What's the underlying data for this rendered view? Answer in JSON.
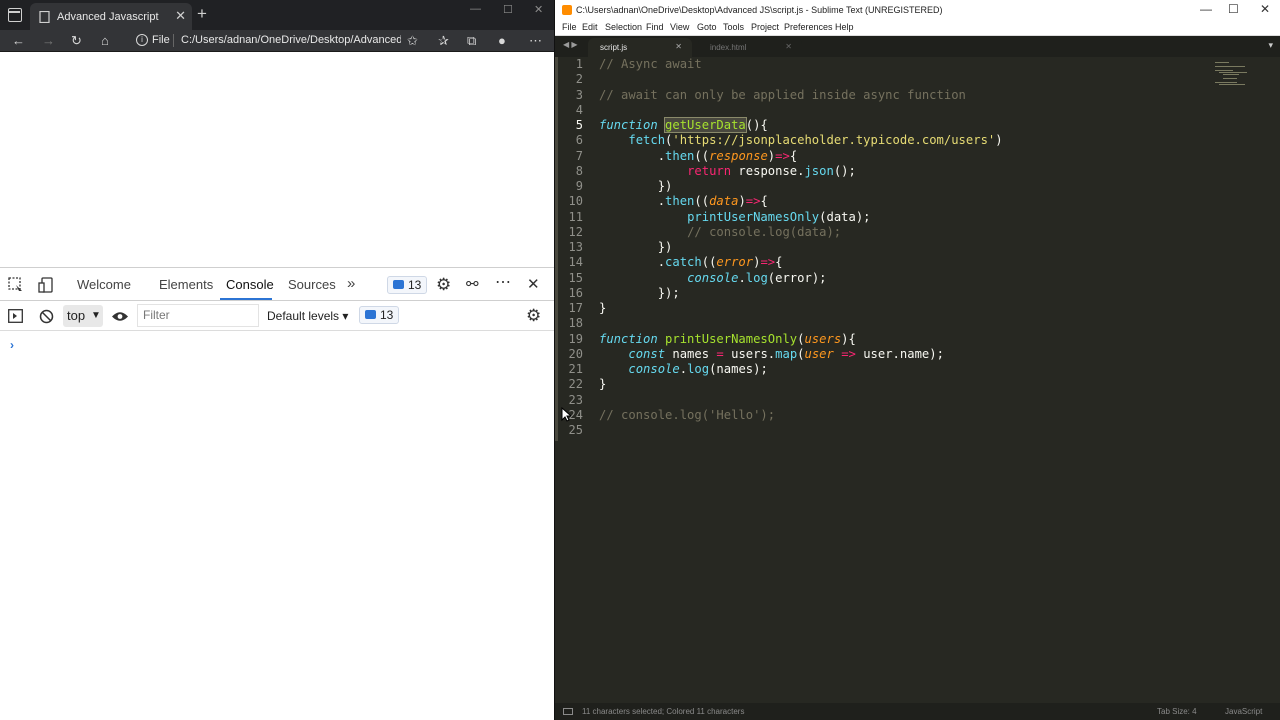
{
  "browser": {
    "tab_title": "Advanced Javascript",
    "tab_close": "✕",
    "new_tab": "+",
    "address": {
      "scheme_label": "File",
      "url": "C:/Users/adnan/OneDrive/Desktop/Advanced%20J..."
    }
  },
  "devtools": {
    "tabs": [
      "Welcome",
      "Elements",
      "Console",
      "Sources"
    ],
    "more_tabs": "»",
    "issues_count": "13",
    "close": "✕",
    "context": "top",
    "filter_placeholder": "Filter",
    "levels": "Default levels",
    "messages_count": "13",
    "prompt": "›"
  },
  "sublime": {
    "title": "C:\\Users\\adnan\\OneDrive\\Desktop\\Advanced JS\\script.js - Sublime Text (UNREGISTERED)",
    "menu": [
      "File",
      "Edit",
      "Selection",
      "Find",
      "View",
      "Goto",
      "Tools",
      "Project",
      "Preferences",
      "Help"
    ],
    "tabs": [
      {
        "name": "script.js",
        "active": true
      },
      {
        "name": "index.html",
        "active": false
      }
    ],
    "current_line": 5,
    "line_numbers": [
      "1",
      "2",
      "3",
      "4",
      "5",
      "6",
      "7",
      "8",
      "9",
      "10",
      "11",
      "12",
      "13",
      "14",
      "15",
      "16",
      "17",
      "18",
      "19",
      "20",
      "21",
      "22",
      "23",
      "24",
      "25"
    ],
    "code": {
      "l1": "// Async await",
      "l3": "// await can only be applied inside async function",
      "l5_kw": "function",
      "l5_fn": "getUserData",
      "l5_rest": "(){",
      "l6_fn": "fetch",
      "l6_p1": "(",
      "l6_str": "'https://jsonplaceholder.typicode.com/users'",
      "l6_p2": ")",
      "l7_a": ".",
      "l7_fn": "then",
      "l7_b": "((",
      "l7_param": "response",
      "l7_c": ")",
      "l7_op": "=>",
      "l7_d": "{",
      "l8_kw": "return",
      "l8_a": " response.",
      "l8_fn": "json",
      "l8_b": "();",
      "l9": "})",
      "l10_a": ".",
      "l10_fn": "then",
      "l10_b": "((",
      "l10_param": "data",
      "l10_c": ")",
      "l10_op": "=>",
      "l10_d": "{",
      "l11_fn": "printUserNamesOnly",
      "l11_b": "(data);",
      "l12": "// console.log(data);",
      "l13": "})",
      "l14_a": ".",
      "l14_fn": "catch",
      "l14_b": "((",
      "l14_param": "error",
      "l14_c": ")",
      "l14_op": "=>",
      "l14_d": "{",
      "l15_kw": "console",
      "l15_a": ".",
      "l15_fn": "log",
      "l15_b": "(error);",
      "l16": "});",
      "l17": "}",
      "l19_kw": "function",
      "l19_fn": "printUserNamesOnly",
      "l19_a": "(",
      "l19_param": "users",
      "l19_b": "){",
      "l20_kw": "const",
      "l20_a": " names ",
      "l20_eq": "=",
      "l20_b": " users.",
      "l20_fn": "map",
      "l20_c": "(",
      "l20_param": "user",
      "l20_op": " =>",
      "l20_d": " user.name);",
      "l21_kw": "console",
      "l21_a": ".",
      "l21_fn": "log",
      "l21_b": "(names);",
      "l22": "}",
      "l24": "// console.log('Hello');"
    },
    "status_left": "11 characters selected; Colored 11 characters",
    "status_tab": "Tab Size: 4",
    "status_syntax": "JavaScript"
  },
  "colors": {
    "editor_bg": "#272822",
    "keyword": "#66d9ef",
    "function": "#a6e22e",
    "string": "#e6db74",
    "param": "#fd971f",
    "operator": "#f92672",
    "comment": "#75715e",
    "devtools_accent": "#2c74d4"
  }
}
